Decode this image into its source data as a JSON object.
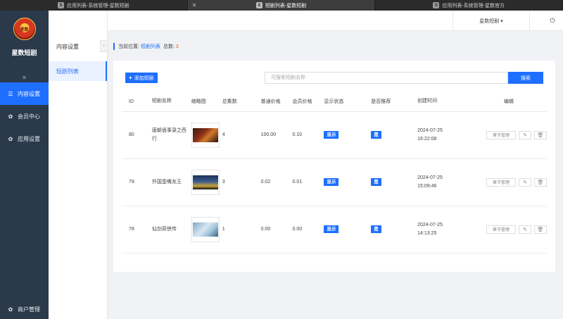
{
  "browser": {
    "tabs": [
      {
        "favicon": "S",
        "title": "应用列表-系统管理-星数短剧"
      },
      {
        "favicon": "S",
        "title": "短剧列表-星数短剧",
        "active": true
      },
      {
        "favicon": "S",
        "title": "应用列表-系统管理-星数官方"
      }
    ],
    "close_glyph": "✕"
  },
  "sidebar": {
    "logo_text": "星数",
    "brand": "星数短剧",
    "toggle_icon": "≡",
    "items": [
      {
        "label": "内容设置",
        "icon": "list-icon",
        "glyph": "☰",
        "active": true
      },
      {
        "label": "会员中心",
        "icon": "gear-icon",
        "glyph": "✿"
      },
      {
        "label": "应用设置",
        "icon": "gear-icon",
        "glyph": "✿"
      }
    ],
    "bottom": {
      "label": "商户管理",
      "icon": "gear-icon",
      "glyph": "✿"
    }
  },
  "submenu": {
    "title": "内容设置",
    "collapse_glyph": "‹",
    "items": [
      {
        "label": "短剧列表",
        "active": true
      }
    ]
  },
  "header": {
    "user": "星数短剧 ▾",
    "power_glyph": "⏻"
  },
  "breadcrumb": {
    "prefix": "当前位置:",
    "current": "短剧列表",
    "total_label": "总数:",
    "total": "3"
  },
  "toolbar": {
    "add_label": "添加短剧",
    "add_glyph": "+",
    "search_placeholder": "可搜索短剧名称",
    "search_value": "",
    "search_label": "搜索"
  },
  "table": {
    "headers": {
      "id": "ID",
      "name": "短剧名称",
      "thumb": "缩略图",
      "episodes": "总集数",
      "price": "普通价格",
      "vip_price": "会员价格",
      "status": "显示状态",
      "recommend": "是否推荐",
      "created": "创建时间",
      "edit": "编辑"
    },
    "rows": [
      {
        "id": "80",
        "name": "唐朝诡事录之西行",
        "episodes": "4",
        "price": "100.00",
        "vip_price": "0.10",
        "status": "显示",
        "recommend": "是",
        "date": "2024-07-25",
        "time": "16:22:08"
      },
      {
        "id": "79",
        "name": "外国歪嘴龙王",
        "episodes": "3",
        "price": "0.02",
        "vip_price": "0.01",
        "status": "显示",
        "recommend": "是",
        "date": "2024-07-25",
        "time": "15:09:46"
      },
      {
        "id": "78",
        "name": "仙剑奇侠传",
        "episodes": "1",
        "price": "0.00",
        "vip_price": "0.00",
        "status": "显示",
        "recommend": "是",
        "date": "2024-07-25",
        "time": "14:13:25"
      }
    ],
    "actions": {
      "chapter": "章节管理",
      "edit_glyph": "✎",
      "delete_glyph": "🗑"
    }
  },
  "colors": {
    "accent": "#1e6fff",
    "sidebar": "#2b3a4a",
    "count": "#e4572e"
  }
}
